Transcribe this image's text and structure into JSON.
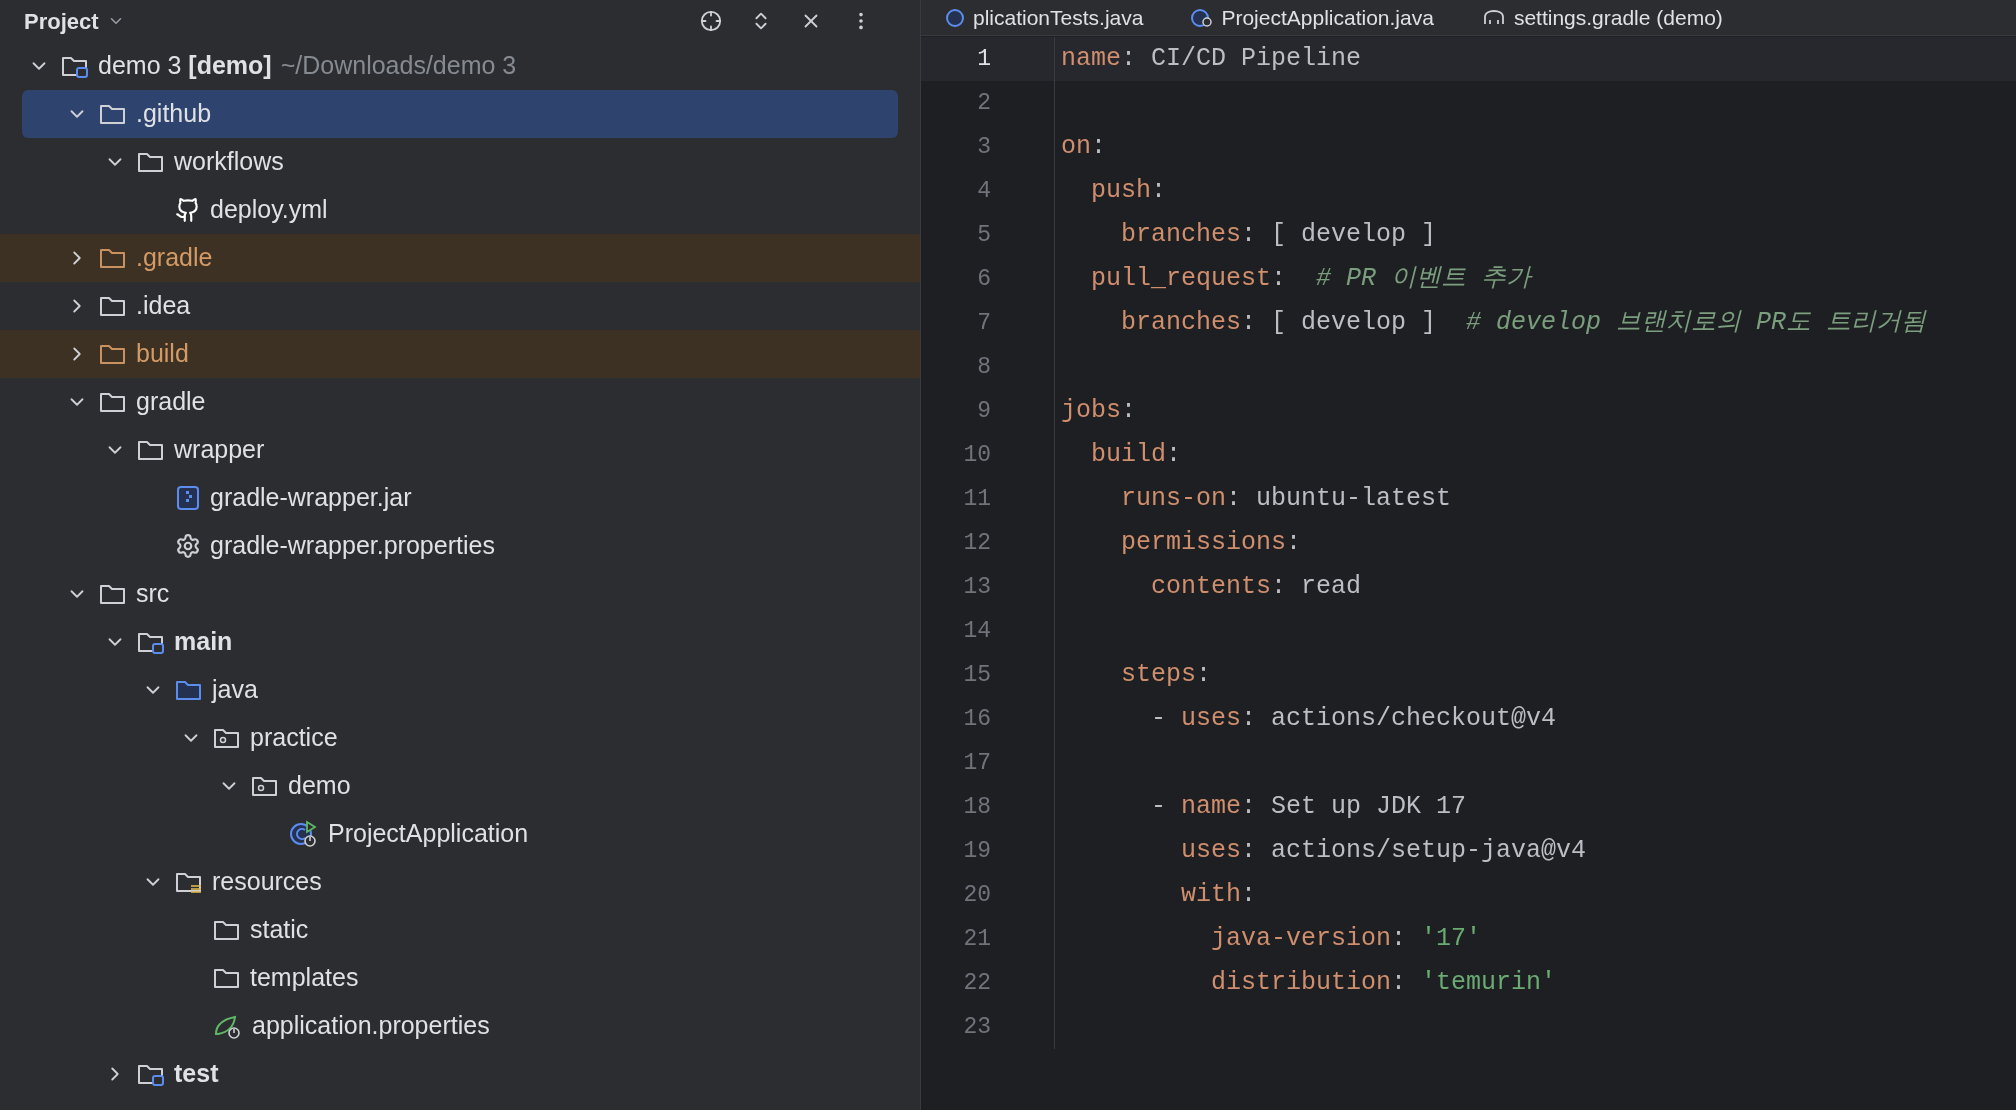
{
  "project_panel": {
    "title": "Project",
    "tree": [
      {
        "kind": "module",
        "label": "demo 3 **[demo]**",
        "hint": "~/Downloads/demo 3",
        "expanded": true,
        "selected": false,
        "excluded": false,
        "children": [
          {
            "kind": "folder",
            "label": ".github",
            "expanded": true,
            "selected": true,
            "excluded": false,
            "children": [
              {
                "kind": "folder",
                "label": "workflows",
                "expanded": true,
                "selected": false,
                "excluded": false,
                "children": [
                  {
                    "kind": "github",
                    "label": "deploy.yml",
                    "selected": false,
                    "excluded": false
                  }
                ]
              }
            ]
          },
          {
            "kind": "folder",
            "label": ".gradle",
            "expanded": false,
            "selected": false,
            "excluded": true
          },
          {
            "kind": "folder",
            "label": ".idea",
            "expanded": false,
            "selected": false,
            "excluded": false
          },
          {
            "kind": "folder",
            "label": "build",
            "expanded": false,
            "selected": false,
            "excluded": true
          },
          {
            "kind": "folder",
            "label": "gradle",
            "expanded": true,
            "selected": false,
            "excluded": false,
            "children": [
              {
                "kind": "folder",
                "label": "wrapper",
                "expanded": true,
                "selected": false,
                "excluded": false,
                "children": [
                  {
                    "kind": "jar",
                    "label": "gradle-wrapper.jar",
                    "selected": false,
                    "excluded": false
                  },
                  {
                    "kind": "gear",
                    "label": "gradle-wrapper.properties",
                    "selected": false,
                    "excluded": false
                  }
                ]
              }
            ]
          },
          {
            "kind": "folder",
            "label": "src",
            "expanded": true,
            "selected": false,
            "excluded": false,
            "children": [
              {
                "kind": "source_root",
                "label": "main",
                "expanded": true,
                "selected": false,
                "excluded": false,
                "children": [
                  {
                    "kind": "java_folder",
                    "label": "java",
                    "expanded": true,
                    "selected": false,
                    "excluded": false,
                    "children": [
                      {
                        "kind": "package",
                        "label": "practice",
                        "expanded": true,
                        "selected": false,
                        "excluded": false,
                        "children": [
                          {
                            "kind": "package",
                            "label": "demo",
                            "expanded": true,
                            "selected": false,
                            "excluded": false,
                            "children": [
                              {
                                "kind": "spring_class",
                                "label": "ProjectApplication",
                                "selected": false,
                                "excluded": false
                              }
                            ]
                          }
                        ]
                      }
                    ]
                  },
                  {
                    "kind": "resources",
                    "label": "resources",
                    "expanded": true,
                    "selected": false,
                    "excluded": false,
                    "children": [
                      {
                        "kind": "folder",
                        "label": "static",
                        "selected": false,
                        "excluded": false
                      },
                      {
                        "kind": "folder",
                        "label": "templates",
                        "selected": false,
                        "excluded": false
                      },
                      {
                        "kind": "spring_props",
                        "label": "application.properties",
                        "selected": false,
                        "excluded": false
                      }
                    ]
                  }
                ]
              },
              {
                "kind": "source_root",
                "label": "test",
                "expanded": false,
                "selected": false,
                "excluded": false
              }
            ]
          }
        ]
      }
    ]
  },
  "editor_tabs": [
    {
      "kind": "java",
      "label": "plicationTests.java"
    },
    {
      "kind": "spring_class",
      "label": "ProjectApplication.java"
    },
    {
      "kind": "gradle",
      "label": "settings.gradle (demo)"
    }
  ],
  "editor": {
    "lines": [
      {
        "number": "1",
        "current": true,
        "tokens": [
          {
            "kind": "key",
            "text": "name"
          },
          {
            "kind": "plain",
            "text": ": CI/CD Pipeline"
          }
        ]
      },
      {
        "number": "2",
        "current": false
      },
      {
        "number": "3",
        "current": false,
        "tokens": [
          {
            "kind": "key",
            "text": "on"
          },
          {
            "kind": "plain",
            "text": ":"
          }
        ]
      },
      {
        "number": "4",
        "current": false,
        "tokens": [
          {
            "kind": "key",
            "text": "  push"
          },
          {
            "kind": "plain",
            "text": ":"
          }
        ]
      },
      {
        "number": "5",
        "current": false,
        "tokens": [
          {
            "kind": "key",
            "text": "    branches"
          },
          {
            "kind": "plain",
            "text": ": [ develop ]"
          }
        ]
      },
      {
        "number": "6",
        "current": false,
        "tokens": [
          {
            "kind": "key",
            "text": "  pull_request"
          },
          {
            "kind": "plain",
            "text": ":  "
          },
          {
            "kind": "comment",
            "text": "# PR 이벤트 추가"
          }
        ]
      },
      {
        "number": "7",
        "current": false,
        "tokens": [
          {
            "kind": "key",
            "text": "    branches"
          },
          {
            "kind": "plain",
            "text": ": [ develop ]  "
          },
          {
            "kind": "comment",
            "text": "# develop 브랜치로의 PR도 트리거됨"
          }
        ]
      },
      {
        "number": "8",
        "current": false
      },
      {
        "number": "9",
        "current": false,
        "tokens": [
          {
            "kind": "key",
            "text": "jobs"
          },
          {
            "kind": "plain",
            "text": ":"
          }
        ]
      },
      {
        "number": "10",
        "current": false,
        "tokens": [
          {
            "kind": "key",
            "text": "  build"
          },
          {
            "kind": "plain",
            "text": ":"
          }
        ]
      },
      {
        "number": "11",
        "current": false,
        "tokens": [
          {
            "kind": "key",
            "text": "    runs-on"
          },
          {
            "kind": "plain",
            "text": ": ubuntu-latest"
          }
        ]
      },
      {
        "number": "12",
        "current": false,
        "tokens": [
          {
            "kind": "key",
            "text": "    permissions"
          },
          {
            "kind": "plain",
            "text": ":"
          }
        ]
      },
      {
        "number": "13",
        "current": false,
        "tokens": [
          {
            "kind": "key",
            "text": "      contents"
          },
          {
            "kind": "plain",
            "text": ": read"
          }
        ]
      },
      {
        "number": "14",
        "current": false
      },
      {
        "number": "15",
        "current": false,
        "tokens": [
          {
            "kind": "key",
            "text": "    steps"
          },
          {
            "kind": "plain",
            "text": ":"
          }
        ]
      },
      {
        "number": "16",
        "current": false,
        "tokens": [
          {
            "kind": "plain",
            "text": "      - "
          },
          {
            "kind": "key",
            "text": "uses"
          },
          {
            "kind": "plain",
            "text": ": actions/checkout@v4"
          }
        ]
      },
      {
        "number": "17",
        "current": false
      },
      {
        "number": "18",
        "current": false,
        "tokens": [
          {
            "kind": "plain",
            "text": "      - "
          },
          {
            "kind": "key",
            "text": "name"
          },
          {
            "kind": "plain",
            "text": ": Set up JDK 17"
          }
        ]
      },
      {
        "number": "19",
        "current": false,
        "tokens": [
          {
            "kind": "key",
            "text": "        uses"
          },
          {
            "kind": "plain",
            "text": ": actions/setup-java@v4"
          }
        ]
      },
      {
        "number": "20",
        "current": false,
        "tokens": [
          {
            "kind": "key",
            "text": "        with"
          },
          {
            "kind": "plain",
            "text": ":"
          }
        ]
      },
      {
        "number": "21",
        "current": false,
        "tokens": [
          {
            "kind": "key",
            "text": "          java-version"
          },
          {
            "kind": "plain",
            "text": ": "
          },
          {
            "kind": "string",
            "text": "'17'"
          }
        ]
      },
      {
        "number": "22",
        "current": false,
        "tokens": [
          {
            "kind": "key",
            "text": "          distribution"
          },
          {
            "kind": "plain",
            "text": ": "
          },
          {
            "kind": "string",
            "text": "'temurin'"
          }
        ]
      },
      {
        "number": "23",
        "current": false
      }
    ]
  }
}
